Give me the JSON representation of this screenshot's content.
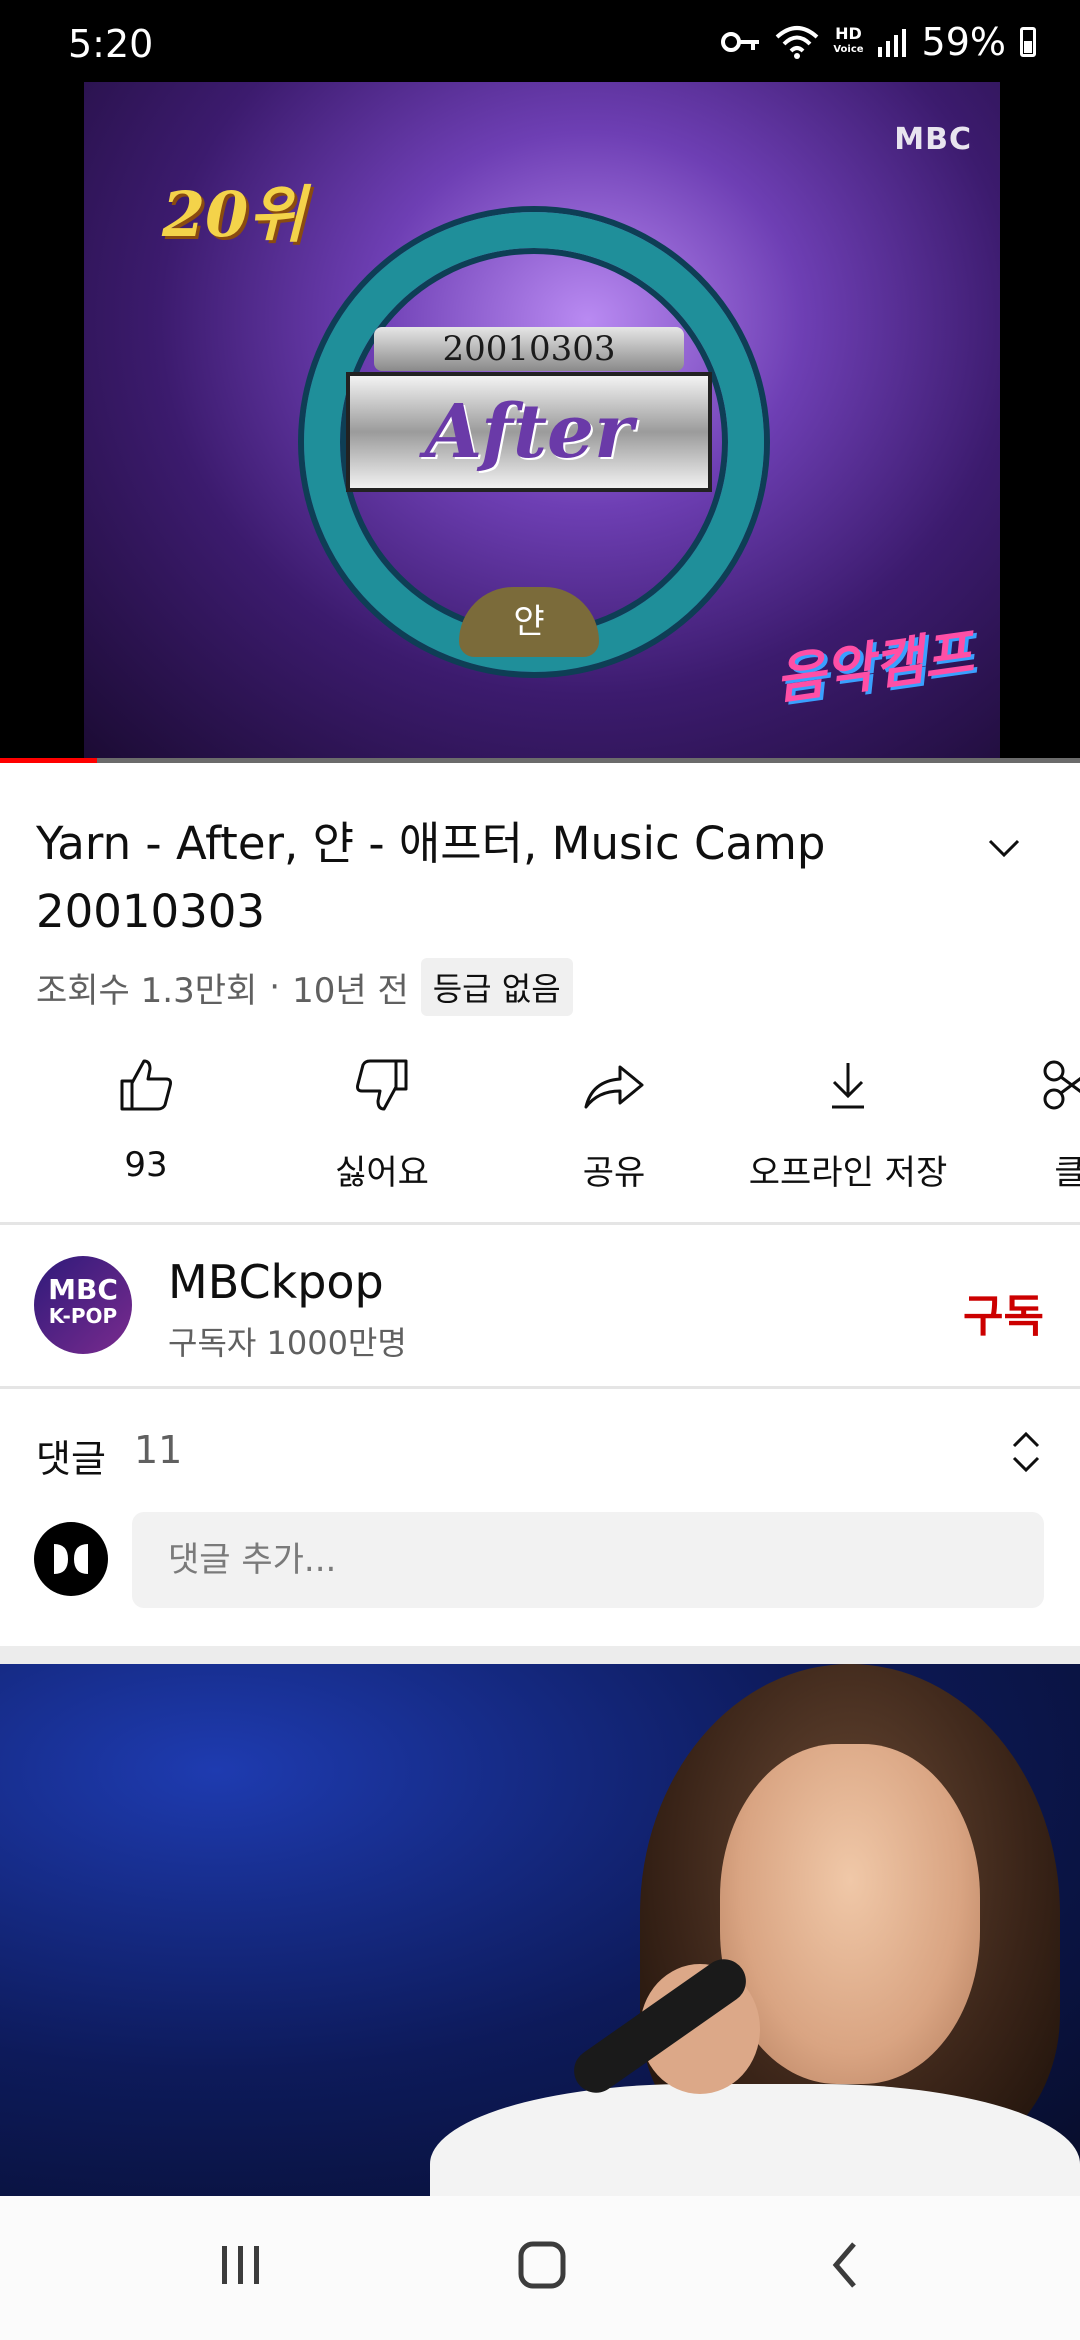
{
  "status_bar": {
    "time": "5:20",
    "network_label": "HD",
    "network_sub": "Voice",
    "battery": "59%"
  },
  "player": {
    "rank_text": "20위",
    "broadcaster_logo": "MBC",
    "date_plate": "20010303",
    "song_plate": "After",
    "artist_plate": "얀",
    "show_logo": "음악캠프",
    "progress_fraction": 0.09,
    "progress_color": "#ff0000"
  },
  "video": {
    "title": "Yarn - After, 얀 - 애프터, Music Camp 20010303",
    "views": "조회수 1.3만회",
    "separator": "·",
    "age": "10년 전",
    "rating_badge": "등급 없음"
  },
  "actions": [
    {
      "icon": "thumbs-up-icon",
      "label": "93"
    },
    {
      "icon": "thumbs-down-icon",
      "label": "싫어요"
    },
    {
      "icon": "share-icon",
      "label": "공유"
    },
    {
      "icon": "download-icon",
      "label": "오프라인 저장"
    },
    {
      "icon": "clip-icon",
      "label": "클"
    }
  ],
  "channel": {
    "avatar_line1": "MBC",
    "avatar_line2": "K-POP",
    "name": "MBCkpop",
    "subscribers": "구독자 1000만명",
    "subscribe_label": "구독",
    "subscribe_color": "#cc0000"
  },
  "comments": {
    "label": "댓글",
    "count": "11",
    "placeholder": "댓글 추가..."
  },
  "navbar": {
    "recent_icon": "recent-apps-icon",
    "home_icon": "home-icon",
    "back_icon": "back-icon"
  }
}
